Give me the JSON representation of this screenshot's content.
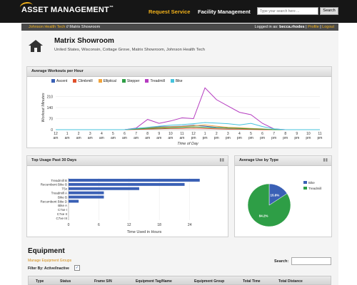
{
  "header": {
    "logo_text": "ASSET MANAGEMENT",
    "logo_tm": "™",
    "nav": [
      "Request Service",
      "Facility Management"
    ],
    "search_placeholder": "Type your search here ...",
    "search_button": "Search"
  },
  "breadcrumb": {
    "items": [
      "Johnson Health Tech",
      "Matrix Showroom"
    ],
    "separator": "//",
    "logged_in_prefix": "Logged in as:",
    "user": "becca.rhodes",
    "profile": "Profile",
    "logout": "Logout"
  },
  "page": {
    "title": "Matrix Showroom",
    "subtitle": "United States, Wisconsin, Cottage Grove, Matrix Showroom, Johnson Health Tech"
  },
  "colors": {
    "ascent": "#3a60b5",
    "climbmill": "#e0502a",
    "elliptical": "#f2a33a",
    "stepper": "#2e9e46",
    "treadmill": "#b53cc0",
    "bike": "#45c3dd",
    "bar": "#3a60b5",
    "accent": "#f3b21a"
  },
  "chart_workouts": {
    "title": "Average Workouts per Hour",
    "ylabel": "Workout Minutes",
    "xlabel": "Time of Day",
    "chart_data": {
      "type": "line",
      "x_ticks": [
        {
          "h": "12",
          "p": "am"
        },
        {
          "h": "1",
          "p": "am"
        },
        {
          "h": "2",
          "p": "am"
        },
        {
          "h": "3",
          "p": "am"
        },
        {
          "h": "4",
          "p": "am"
        },
        {
          "h": "5",
          "p": "am"
        },
        {
          "h": "6",
          "p": "am"
        },
        {
          "h": "7",
          "p": "am"
        },
        {
          "h": "8",
          "p": "am"
        },
        {
          "h": "9",
          "p": "am"
        },
        {
          "h": "10",
          "p": "am"
        },
        {
          "h": "11",
          "p": "am"
        },
        {
          "h": "12",
          "p": "pm"
        },
        {
          "h": "1",
          "p": "pm"
        },
        {
          "h": "2",
          "p": "pm"
        },
        {
          "h": "3",
          "p": "pm"
        },
        {
          "h": "4",
          "p": "pm"
        },
        {
          "h": "5",
          "p": "pm"
        },
        {
          "h": "6",
          "p": "pm"
        },
        {
          "h": "7",
          "p": "pm"
        },
        {
          "h": "8",
          "p": "pm"
        },
        {
          "h": "9",
          "p": "pm"
        },
        {
          "h": "10",
          "p": "pm"
        },
        {
          "h": "11",
          "p": "pm"
        }
      ],
      "y_ticks": [
        0,
        70,
        140,
        210
      ],
      "ylim": [
        0,
        280
      ],
      "series": [
        {
          "name": "Ascent",
          "color_key": "ascent",
          "values": [
            0,
            0,
            0,
            0,
            0,
            0,
            0,
            8,
            12,
            18,
            20,
            22,
            28,
            22,
            15,
            10,
            8,
            6,
            4,
            0,
            0,
            0,
            0,
            0
          ]
        },
        {
          "name": "Climbmill",
          "color_key": "climbmill",
          "values": [
            0,
            0,
            0,
            0,
            0,
            0,
            0,
            2,
            4,
            6,
            8,
            8,
            10,
            8,
            6,
            4,
            3,
            2,
            0,
            0,
            0,
            0,
            0,
            0
          ]
        },
        {
          "name": "Elliptical",
          "color_key": "elliptical",
          "values": [
            0,
            0,
            0,
            0,
            0,
            0,
            0,
            5,
            10,
            15,
            18,
            20,
            25,
            30,
            22,
            15,
            12,
            8,
            5,
            0,
            0,
            0,
            0,
            0
          ]
        },
        {
          "name": "Stepper",
          "color_key": "stepper",
          "values": [
            0,
            0,
            0,
            0,
            0,
            0,
            0,
            4,
            8,
            10,
            12,
            15,
            18,
            15,
            12,
            10,
            8,
            5,
            3,
            0,
            0,
            0,
            0,
            0
          ]
        },
        {
          "name": "Treadmill",
          "color_key": "treadmill",
          "values": [
            0,
            0,
            0,
            0,
            0,
            0,
            0,
            10,
            65,
            40,
            55,
            75,
            70,
            265,
            190,
            150,
            110,
            95,
            40,
            5,
            0,
            0,
            0,
            0
          ]
        },
        {
          "name": "Bike",
          "color_key": "bike",
          "values": [
            0,
            0,
            0,
            0,
            0,
            0,
            0,
            8,
            15,
            22,
            28,
            32,
            38,
            45,
            42,
            38,
            30,
            40,
            20,
            5,
            0,
            0,
            0,
            0
          ]
        }
      ]
    }
  },
  "chart_usage": {
    "title": "Top Usage Past 30 Days",
    "xlabel": "Time Used in Hours",
    "chart_data": {
      "type": "bar",
      "orientation": "horizontal",
      "categories": [
        "Treadmill B",
        "Recumbent Bike B",
        "T5x",
        "Treadmill A",
        "Bike B",
        "Recumbent Bike D",
        "Bike A",
        "C7xe I",
        "C7xe II",
        "C7xe III"
      ],
      "values": [
        26,
        23,
        14,
        7,
        7,
        2,
        0,
        0,
        0,
        0
      ],
      "x_ticks": [
        0,
        6,
        12,
        18,
        24
      ],
      "xlim": [
        0,
        30
      ]
    }
  },
  "chart_type": {
    "title": "Average Use by Type",
    "chart_data": {
      "type": "pie",
      "slices": [
        {
          "name": "Bike",
          "value": 15.8,
          "label": "15.8%",
          "color_key": "ascent"
        },
        {
          "name": "Treadmill",
          "value": 84.2,
          "label": "84.2%",
          "color_key": "stepper"
        }
      ]
    }
  },
  "equipment": {
    "title": "Equipment",
    "manage_link": "Manage Equipment Groups",
    "filter_label": "Filter By: Active/Inactive",
    "filter_checked": "✓",
    "search_label": "Search:",
    "columns": [
      "Type",
      "Status",
      "Frame S/N",
      "Equipment Tag/Name",
      "Equipment Group",
      "Total Time",
      "Total Distance"
    ]
  }
}
